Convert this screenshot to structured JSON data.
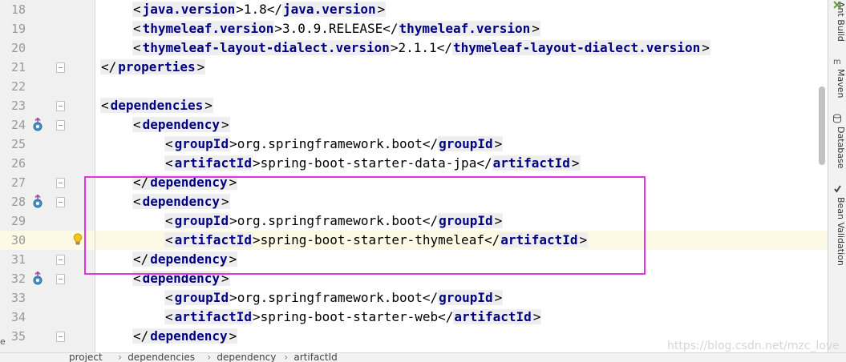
{
  "editor": {
    "first_line": 18,
    "current_line": 30,
    "lines": [
      {
        "n": "18",
        "parts": [
          {
            "t": "<"
          },
          {
            "k": "java.version"
          },
          {
            "t": ">1.8</"
          },
          {
            "k": "java.version"
          },
          {
            "t": ">"
          }
        ]
      },
      {
        "n": "19",
        "parts": [
          {
            "t": "<"
          },
          {
            "k": "thymeleaf.version"
          },
          {
            "t": ">3.0.9.RELEASE</"
          },
          {
            "k": "thymeleaf.version"
          },
          {
            "t": ">"
          }
        ]
      },
      {
        "n": "20",
        "parts": [
          {
            "t": "<"
          },
          {
            "k": "thymeleaf-layout-dialect.version"
          },
          {
            "t": ">2.1.1</"
          },
          {
            "k": "thymeleaf-layout-dialect.version"
          },
          {
            "t": ">"
          }
        ]
      },
      {
        "n": "21",
        "parts": [
          {
            "t": "</"
          },
          {
            "k": "properties"
          },
          {
            "t": ">"
          }
        ]
      },
      {
        "n": "22",
        "parts": []
      },
      {
        "n": "23",
        "parts": [
          {
            "t": "<"
          },
          {
            "k": "dependencies"
          },
          {
            "t": ">"
          }
        ]
      },
      {
        "n": "24",
        "parts": [
          {
            "t": "<"
          },
          {
            "k": "dependency"
          },
          {
            "t": ">"
          }
        ]
      },
      {
        "n": "25",
        "parts": [
          {
            "t": "<"
          },
          {
            "k": "groupId"
          },
          {
            "t": ">org.springframework.boot</"
          },
          {
            "k": "groupId"
          },
          {
            "t": ">"
          }
        ]
      },
      {
        "n": "26",
        "parts": [
          {
            "t": "<"
          },
          {
            "k": "artifactId"
          },
          {
            "t": ">spring-boot-starter-data-jpa</"
          },
          {
            "k": "artifactId"
          },
          {
            "t": ">"
          }
        ]
      },
      {
        "n": "27",
        "parts": [
          {
            "t": "</"
          },
          {
            "k": "dependency"
          },
          {
            "t": ">"
          }
        ]
      },
      {
        "n": "28",
        "parts": [
          {
            "t": "<"
          },
          {
            "k": "dependency"
          },
          {
            "t": ">"
          }
        ]
      },
      {
        "n": "29",
        "parts": [
          {
            "t": "<"
          },
          {
            "k": "groupId"
          },
          {
            "t": ">org.springframework.boot</"
          },
          {
            "k": "groupId"
          },
          {
            "t": ">"
          }
        ]
      },
      {
        "n": "30",
        "parts": [
          {
            "t": "<"
          },
          {
            "k": "artifactId"
          },
          {
            "t": ">spring-boot-starter-thymeleaf</"
          },
          {
            "k": "artifactId"
          },
          {
            "t": ">"
          }
        ]
      },
      {
        "n": "31",
        "parts": [
          {
            "t": "</"
          },
          {
            "k": "dependency"
          },
          {
            "t": ">"
          }
        ]
      },
      {
        "n": "32",
        "parts": [
          {
            "t": "<"
          },
          {
            "k": "dependency"
          },
          {
            "t": ">"
          }
        ]
      },
      {
        "n": "33",
        "parts": [
          {
            "t": "<"
          },
          {
            "k": "groupId"
          },
          {
            "t": ">org.springframework.boot</"
          },
          {
            "k": "groupId"
          },
          {
            "t": ">"
          }
        ]
      },
      {
        "n": "34",
        "parts": [
          {
            "t": "<"
          },
          {
            "k": "artifactId"
          },
          {
            "t": ">spring-boot-starter-web</"
          },
          {
            "k": "artifactId"
          },
          {
            "t": ">"
          }
        ]
      },
      {
        "n": "35",
        "parts": [
          {
            "t": "</"
          },
          {
            "k": "dependency"
          },
          {
            "t": ">"
          }
        ]
      }
    ],
    "indent_levels": [
      1,
      1,
      1,
      0,
      0,
      0,
      1,
      2,
      2,
      1,
      1,
      2,
      2,
      1,
      1,
      2,
      2,
      1
    ],
    "fold_marks": [
      "21",
      "23",
      "24",
      "27",
      "28",
      "31",
      "32",
      "35"
    ],
    "override_icon_lines": [
      "24",
      "28",
      "32"
    ],
    "intention_bulb_line": "30"
  },
  "colors": {
    "tag": "#000080",
    "current_line_bg": "#fcfae4",
    "annotation_frame": "#e433e4",
    "gutter_bg": "#f0f0f0"
  },
  "side_tabs": [
    "Ant Build",
    "Maven",
    "Database",
    "Bean Validation"
  ],
  "side_tab_icons": [
    "ant-icon",
    "maven-icon",
    "database-icon",
    "bean-validation-icon"
  ],
  "breadcrumb": [
    "project",
    "dependencies",
    "dependency",
    "artifactId"
  ],
  "watermark": "https://blog.csdn.net/mzc_love"
}
